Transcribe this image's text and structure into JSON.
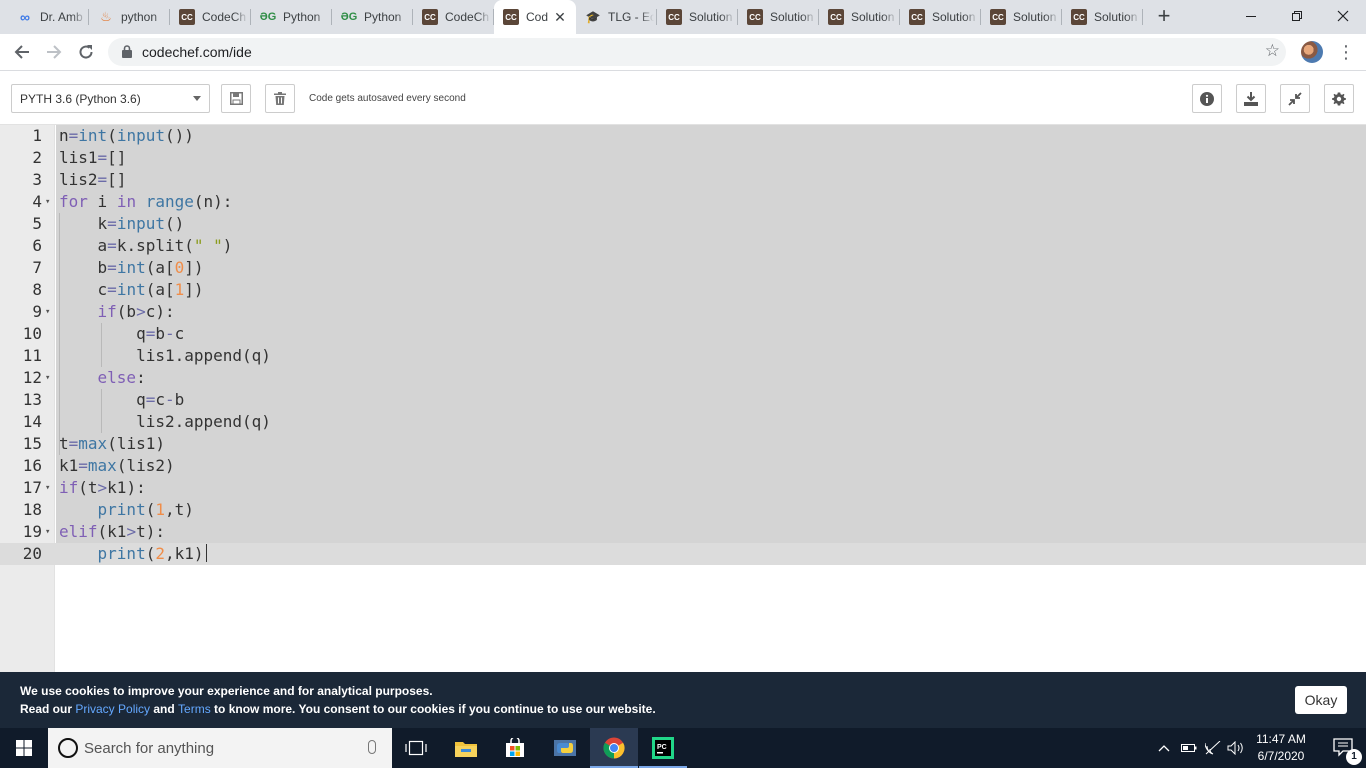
{
  "browser": {
    "tabs": [
      {
        "label": "Dr. Amb",
        "icon": "infinity-icon",
        "active": false
      },
      {
        "label": "python",
        "icon": "python-icon",
        "active": false
      },
      {
        "label": "CodeCh",
        "icon": "codechef-icon",
        "active": false
      },
      {
        "label": "Python",
        "icon": "gfg-icon",
        "active": false
      },
      {
        "label": "Python",
        "icon": "gfg-icon",
        "active": false
      },
      {
        "label": "CodeCh",
        "icon": "codechef-icon",
        "active": false
      },
      {
        "label": "Cod",
        "icon": "codechef-icon",
        "active": true
      },
      {
        "label": "TLG - Ec",
        "icon": "tlg-icon",
        "active": false
      },
      {
        "label": "Solution",
        "icon": "codechef-icon",
        "active": false
      },
      {
        "label": "Solution",
        "icon": "codechef-icon",
        "active": false
      },
      {
        "label": "Solution",
        "icon": "codechef-icon",
        "active": false
      },
      {
        "label": "Solution",
        "icon": "codechef-icon",
        "active": false
      },
      {
        "label": "Solution",
        "icon": "codechef-icon",
        "active": false
      },
      {
        "label": "Solution",
        "icon": "codechef-icon",
        "active": false
      }
    ],
    "url": "codechef.com/ide"
  },
  "ide": {
    "language": "PYTH 3.6 (Python 3.6)",
    "autosave_text": "Code gets autosaved every second"
  },
  "editor": {
    "lines": [
      "n=int(input())",
      "lis1=[]",
      "lis2=[]",
      "for i in range(n):",
      "    k=input()",
      "    a=k.split(\" \")",
      "    b=int(a[0])",
      "    c=int(a[1])",
      "    if(b>c):",
      "        q=b-c",
      "        lis1.append(q)",
      "    else:",
      "        q=c-b",
      "        lis2.append(q)",
      "t=max(lis1)",
      "k1=max(lis2)",
      "if(t>k1):",
      "    print(1,t)",
      "elif(k1>t):",
      "    print(2,k1)"
    ],
    "fold_lines": [
      4,
      9,
      12,
      17,
      19
    ],
    "active_line": 20
  },
  "cookie": {
    "line1": "We use cookies to improve your experience and for analytical purposes.",
    "line2_a": "Read our ",
    "privacy_link": "Privacy Policy",
    "line2_b": " and ",
    "terms_link": "Terms",
    "line2_c": " to know more. You consent to our cookies if you continue to use our website.",
    "ok_label": "Okay"
  },
  "taskbar": {
    "search_placeholder": "Search for anything",
    "time": "11:47 AM",
    "date": "6/7/2020",
    "notification_count": "1"
  }
}
